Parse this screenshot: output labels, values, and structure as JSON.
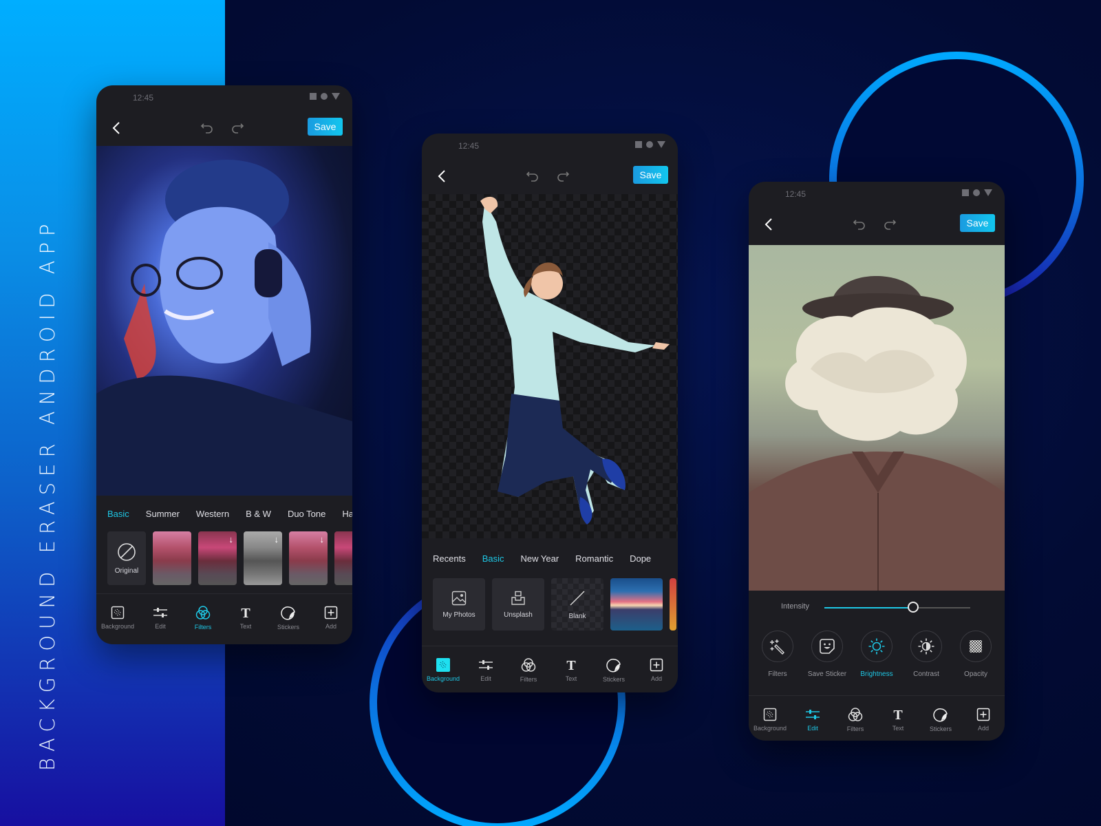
{
  "title": "BACKGROUND ERASER ANDROID APP",
  "colors": {
    "accent": "#1ec8e6",
    "save_bg": "#12a8e6",
    "panel": "#1d1d22",
    "background": "#00072a"
  },
  "phones": [
    {
      "status": {
        "time": "12:45"
      },
      "save_label": "Save",
      "tabs": [
        {
          "label": "Basic",
          "active": true
        },
        {
          "label": "Summer"
        },
        {
          "label": "Western"
        },
        {
          "label": "B & W"
        },
        {
          "label": "Duo Tone"
        },
        {
          "label": "Ha"
        }
      ],
      "thumbs": {
        "original_label": "Original"
      },
      "nav": [
        {
          "label": "Background",
          "icon": "background-icon"
        },
        {
          "label": "Edit",
          "icon": "sliders-icon"
        },
        {
          "label": "Filters",
          "icon": "filters-icon",
          "active": true
        },
        {
          "label": "Text",
          "icon": "text-icon"
        },
        {
          "label": "Stickers",
          "icon": "sticker-icon"
        },
        {
          "label": "Add",
          "icon": "add-icon"
        }
      ]
    },
    {
      "status": {
        "time": "12:45"
      },
      "save_label": "Save",
      "tabs": [
        {
          "label": "Recents"
        },
        {
          "label": "Basic",
          "active": true
        },
        {
          "label": "New Year"
        },
        {
          "label": "Romantic"
        },
        {
          "label": "Dope"
        }
      ],
      "tiles": [
        {
          "label": "My Photos",
          "icon": "image-icon"
        },
        {
          "label": "Unsplash",
          "icon": "unsplash-icon"
        },
        {
          "label": "Blank",
          "icon": "blank-icon"
        }
      ],
      "nav": [
        {
          "label": "Background",
          "icon": "background-icon",
          "active": true
        },
        {
          "label": "Edit",
          "icon": "sliders-icon"
        },
        {
          "label": "Filters",
          "icon": "filters-icon"
        },
        {
          "label": "Text",
          "icon": "text-icon"
        },
        {
          "label": "Stickers",
          "icon": "sticker-icon"
        },
        {
          "label": "Add",
          "icon": "add-icon"
        }
      ]
    },
    {
      "status": {
        "time": "12:45"
      },
      "save_label": "Save",
      "intensity": {
        "label": "Intensity",
        "value_percent": 61
      },
      "tools": [
        {
          "label": "Filters",
          "icon": "magic-wand-icon"
        },
        {
          "label": "Save Sticker",
          "icon": "smiley-sticker-icon"
        },
        {
          "label": "Brightness",
          "icon": "brightness-icon",
          "active": true
        },
        {
          "label": "Contrast",
          "icon": "contrast-icon"
        },
        {
          "label": "Opacity",
          "icon": "opacity-icon"
        }
      ],
      "nav": [
        {
          "label": "Background",
          "icon": "background-icon"
        },
        {
          "label": "Edit",
          "icon": "sliders-icon",
          "active": true
        },
        {
          "label": "Filters",
          "icon": "filters-icon"
        },
        {
          "label": "Text",
          "icon": "text-icon"
        },
        {
          "label": "Stickers",
          "icon": "sticker-icon"
        },
        {
          "label": "Add",
          "icon": "add-icon"
        }
      ]
    }
  ]
}
